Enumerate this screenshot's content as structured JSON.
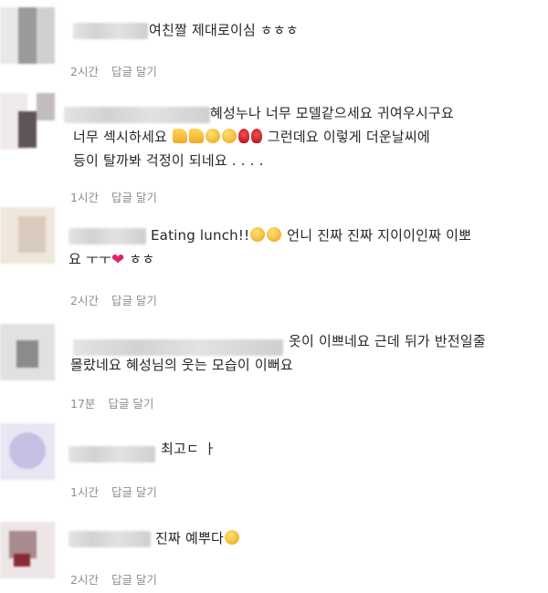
{
  "comments": [
    {
      "lines": [
        "여친짤 제대로이심 ㅎㅎㅎ"
      ],
      "time": "2시간",
      "reply_label": "답글 달기"
    },
    {
      "lines": [
        "혜성누나 너무 모델같으세요 귀여우시구요",
        "너무 섹시하세요",
        "그런데요 이렇게 더운날씨에",
        "등이 탈까봐 걱정이 되네요 . . . ."
      ],
      "time": "1시간",
      "reply_label": "답글 달기"
    },
    {
      "lines": [
        "Eating lunch!!",
        "언니 진짜 진짜 지이이인짜 이뽀",
        "요 ㅜㅜ",
        "ㅎㅎ"
      ],
      "time": "2시간",
      "reply_label": "답글 달기"
    },
    {
      "lines": [
        "옷이 이쁘네요 근데 뒤가 반전일줄",
        "몰랐네요 혜성님의 웃는 모습이 이뻐요"
      ],
      "time": "17분",
      "reply_label": "답글 달기"
    },
    {
      "lines": [
        "최고ㄷ ㅏ"
      ],
      "time": "1시간",
      "reply_label": "답글 달기"
    },
    {
      "lines": [
        "진짜 예뿌다"
      ],
      "time": "2시간",
      "reply_label": "답글 달기"
    }
  ],
  "icons": [
    "thumbs-up-emoji",
    "kiss-emoji",
    "rose-emoji",
    "laughing-emoji",
    "smile-emoji",
    "heart-emoji",
    "surprised-emoji"
  ],
  "colors": {
    "text": "#262626",
    "meta": "#8e8e8e",
    "heart": "#e0245e"
  }
}
